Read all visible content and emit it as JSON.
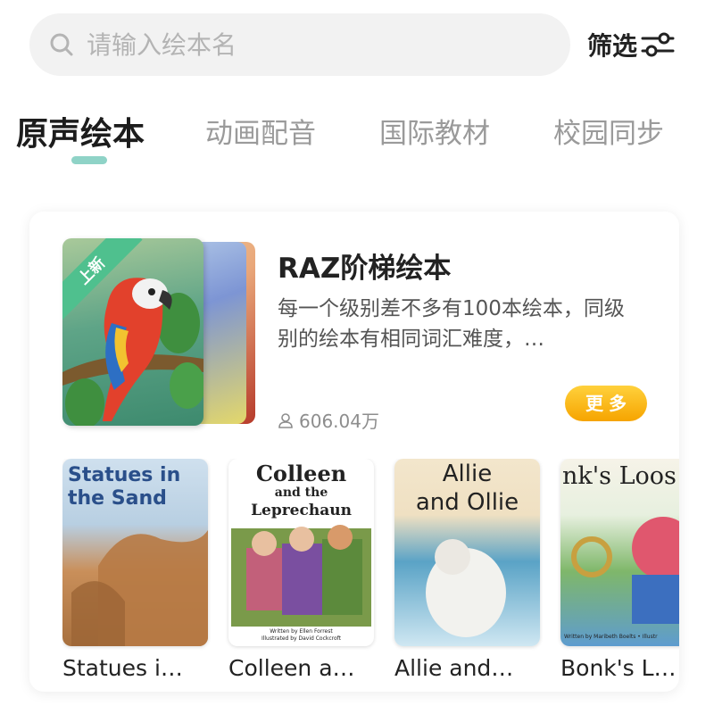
{
  "search": {
    "placeholder": "请输入绘本名"
  },
  "filter": {
    "label": "筛选"
  },
  "tabs": [
    {
      "label": "原声绘本",
      "active": true
    },
    {
      "label": "动画配音",
      "active": false
    },
    {
      "label": "国际教材",
      "active": false
    },
    {
      "label": "校园同步",
      "active": false
    }
  ],
  "series": {
    "badge": "上新",
    "title": "RAZ阶梯绘本",
    "description": "每一个级别差不多有100本绘本，同级别的绘本有相同词汇难度，…",
    "reads": "606.04万",
    "more_label": "更多"
  },
  "books": [
    {
      "name": "Statues i…",
      "cover_title": "Statues in the Sand"
    },
    {
      "name": "Colleen a…",
      "cover_title_1": "Colleen",
      "cover_title_2": "and the",
      "cover_title_3": "Leprechaun",
      "credit_1": "Written by Ellen Forrest",
      "credit_2": "Illustrated by David Cockcroft"
    },
    {
      "name": "Allie and…",
      "cover_title_1": "Allie",
      "cover_title_2": "and Ollie"
    },
    {
      "name": "Bonk's L…",
      "cover_title": "nk's Loos",
      "credit": "Written by Maribeth Boelts • Illustr"
    }
  ],
  "colors": {
    "accent": "#8fd3c7",
    "more_button": "#f6a400",
    "ribbon": "#4fc08e"
  }
}
